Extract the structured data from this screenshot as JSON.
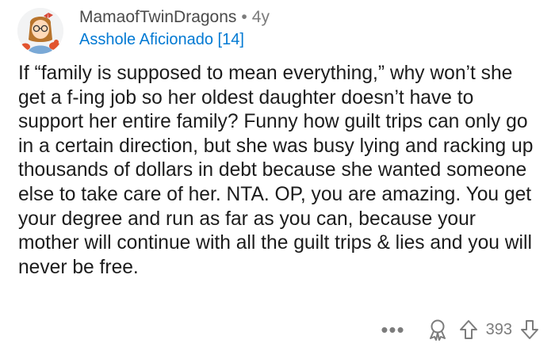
{
  "comment": {
    "username": "MamaofTwinDragons",
    "separator": "•",
    "age": "4y",
    "flair": "Asshole Aficionado [14]",
    "body": "If “family is supposed to mean everything,” why won’t she get a f-ing job so her oldest daughter doesn’t have to support her entire family? Funny how guilt trips can only go in a certain direction, but she was busy lying and racking up thousands of dollars in debt because she wanted someone else to take care of her. NTA. OP, you are amazing. You get your degree and run as far as you can, because your mother will continue with all the guilt trips & lies and you will never be free."
  },
  "actions": {
    "more_label": "•••",
    "score": "393"
  },
  "icons": {
    "avatar": "avatar-icon",
    "more": "more-options-icon",
    "award": "award-icon",
    "upvote": "upvote-arrow-icon",
    "downvote": "downvote-arrow-icon"
  },
  "colors": {
    "flair": "#0079d3",
    "meta": "#7c7c7c",
    "text": "#1c1c1c"
  }
}
